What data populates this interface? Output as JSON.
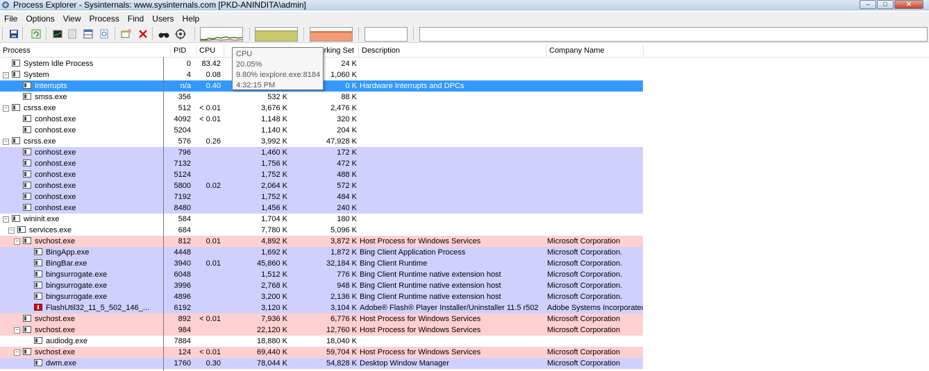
{
  "window": {
    "title": "Process Explorer - Sysinternals: www.sysinternals.com [PKD-ANINDITA\\admin]",
    "minimize": "–",
    "maximize": "□",
    "close": "✕"
  },
  "menu": [
    "File",
    "Options",
    "View",
    "Process",
    "Find",
    "Users",
    "Help"
  ],
  "toolbar_icons": [
    "save-icon",
    "refresh-icon",
    "system-info-icon",
    "properties-icon",
    "lower-pane-icon",
    "dll-icon",
    "window-icon",
    "kill-icon",
    "find-icon",
    "target-icon"
  ],
  "colors": {
    "services": "#ffd0d0",
    "own_process": "#d0d0ff",
    "selected": "#3399ff",
    "cpu_graph": "#1a8a1a",
    "commit_graph": "#c9c96a",
    "io_graph": "#f29c7a"
  },
  "columns": {
    "process": "Process",
    "pid": "PID",
    "cpu": "CPU",
    "private_bytes": "",
    "working_set": "Working Set",
    "description": "Description",
    "company": "Company Name"
  },
  "tooltip": {
    "title": "CPU",
    "value": "20.05%",
    "top": "9.80% iexplore.exe:8184",
    "time": "4:32:15 PM"
  },
  "processes": [
    {
      "name": "System Idle Process",
      "pid": "0",
      "cpu": "83.42",
      "priv": "",
      "ws": "24 K",
      "desc": "",
      "company": ""
    },
    {
      "name": "System",
      "pid": "4",
      "cpu": "0.08",
      "priv": "",
      "ws": "1,060 K",
      "desc": "",
      "company": ""
    },
    {
      "name": "Interrupts",
      "pid": "n/a",
      "cpu": "0.40",
      "priv": "",
      "ws": "0 K",
      "desc": "Hardware Interrupts and DPCs",
      "company": ""
    },
    {
      "name": "smss.exe",
      "pid": "356",
      "cpu": "",
      "priv": "532 K",
      "ws": "88 K",
      "desc": "",
      "company": ""
    },
    {
      "name": "csrss.exe",
      "pid": "512",
      "cpu": "< 0.01",
      "priv": "3,676 K",
      "ws": "2,476 K",
      "desc": "",
      "company": ""
    },
    {
      "name": "conhost.exe",
      "pid": "4092",
      "cpu": "< 0.01",
      "priv": "1,148 K",
      "ws": "320 K",
      "desc": "",
      "company": ""
    },
    {
      "name": "conhost.exe",
      "pid": "5204",
      "cpu": "",
      "priv": "1,140 K",
      "ws": "204 K",
      "desc": "",
      "company": ""
    },
    {
      "name": "csrss.exe",
      "pid": "576",
      "cpu": "0.26",
      "priv": "3,992 K",
      "ws": "47,928 K",
      "desc": "",
      "company": ""
    },
    {
      "name": "conhost.exe",
      "pid": "796",
      "cpu": "",
      "priv": "1,460 K",
      "ws": "172 K",
      "desc": "",
      "company": ""
    },
    {
      "name": "conhost.exe",
      "pid": "7132",
      "cpu": "",
      "priv": "1,756 K",
      "ws": "472 K",
      "desc": "",
      "company": ""
    },
    {
      "name": "conhost.exe",
      "pid": "5124",
      "cpu": "",
      "priv": "1,752 K",
      "ws": "488 K",
      "desc": "",
      "company": ""
    },
    {
      "name": "conhost.exe",
      "pid": "5800",
      "cpu": "0.02",
      "priv": "2,064 K",
      "ws": "572 K",
      "desc": "",
      "company": ""
    },
    {
      "name": "conhost.exe",
      "pid": "7192",
      "cpu": "",
      "priv": "1,752 K",
      "ws": "484 K",
      "desc": "",
      "company": ""
    },
    {
      "name": "conhost.exe",
      "pid": "8480",
      "cpu": "",
      "priv": "1,456 K",
      "ws": "240 K",
      "desc": "",
      "company": ""
    },
    {
      "name": "wininit.exe",
      "pid": "584",
      "cpu": "",
      "priv": "1,704 K",
      "ws": "180 K",
      "desc": "",
      "company": ""
    },
    {
      "name": "services.exe",
      "pid": "684",
      "cpu": "",
      "priv": "7,780 K",
      "ws": "5,096 K",
      "desc": "",
      "company": ""
    },
    {
      "name": "svchost.exe",
      "pid": "812",
      "cpu": "0.01",
      "priv": "4,892 K",
      "ws": "3,872 K",
      "desc": "Host Process for Windows Services",
      "company": "Microsoft Corporation"
    },
    {
      "name": "BingApp.exe",
      "pid": "4448",
      "cpu": "",
      "priv": "1,692 K",
      "ws": "1,872 K",
      "desc": "Bing Client Application Process",
      "company": "Microsoft Corporation."
    },
    {
      "name": "BingBar.exe",
      "pid": "3940",
      "cpu": "0.01",
      "priv": "45,860 K",
      "ws": "32,184 K",
      "desc": "Bing Client Runtime",
      "company": "Microsoft Corporation."
    },
    {
      "name": "bingsurrogate.exe",
      "pid": "6048",
      "cpu": "",
      "priv": "1,512 K",
      "ws": "776 K",
      "desc": "Bing Client Runtime native extension host",
      "company": "Microsoft Corporation."
    },
    {
      "name": "bingsurrogate.exe",
      "pid": "3996",
      "cpu": "",
      "priv": "2,768 K",
      "ws": "948 K",
      "desc": "Bing Client Runtime native extension host",
      "company": "Microsoft Corporation."
    },
    {
      "name": "bingsurrogate.exe",
      "pid": "4896",
      "cpu": "",
      "priv": "3,200 K",
      "ws": "2,136 K",
      "desc": "Bing Client Runtime native extension host",
      "company": "Microsoft Corporation."
    },
    {
      "name": "FlashUtil32_11_5_502_146_...",
      "pid": "6192",
      "cpu": "",
      "priv": "3,120 K",
      "ws": "3,104 K",
      "desc": "Adobe® Flash® Player Installer/Uninstaller 11.5 r502",
      "company": "Adobe Systems Incorporated"
    },
    {
      "name": "svchost.exe",
      "pid": "892",
      "cpu": "< 0.01",
      "priv": "7,936 K",
      "ws": "6,776 K",
      "desc": "Host Process for Windows Services",
      "company": "Microsoft Corporation"
    },
    {
      "name": "svchost.exe",
      "pid": "984",
      "cpu": "",
      "priv": "22,120 K",
      "ws": "12,760 K",
      "desc": "Host Process for Windows Services",
      "company": "Microsoft Corporation"
    },
    {
      "name": "audiodg.exe",
      "pid": "7884",
      "cpu": "",
      "priv": "18,880 K",
      "ws": "18,040 K",
      "desc": "",
      "company": ""
    },
    {
      "name": "svchost.exe",
      "pid": "124",
      "cpu": "< 0.01",
      "priv": "69,440 K",
      "ws": "59,704 K",
      "desc": "Host Process for Windows Services",
      "company": "Microsoft Corporation"
    },
    {
      "name": "dwm.exe",
      "pid": "1760",
      "cpu": "0.30",
      "priv": "78,044 K",
      "ws": "54,828 K",
      "desc": "Desktop Window Manager",
      "company": "Microsoft Corporation"
    }
  ]
}
